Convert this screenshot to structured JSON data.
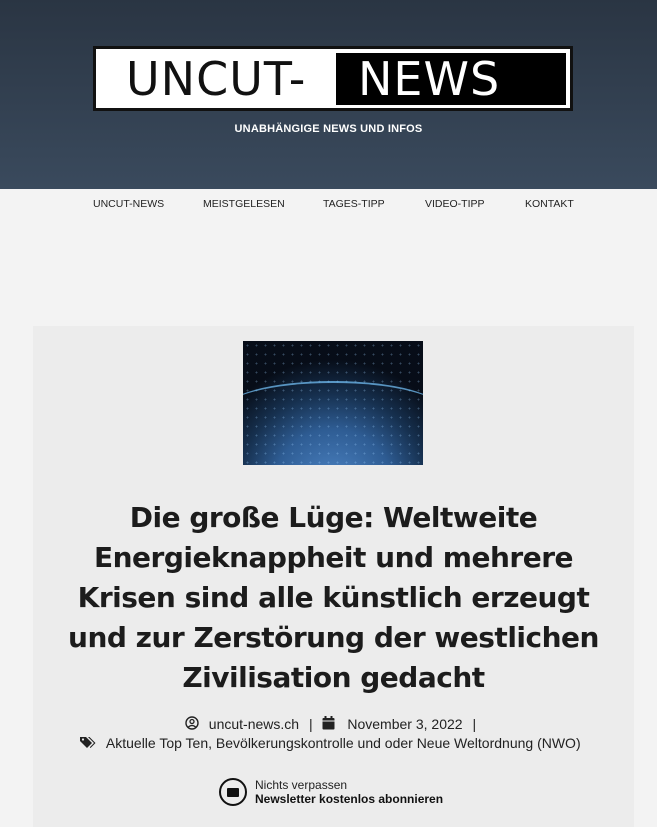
{
  "header": {
    "logo_left": "UNCUT-",
    "logo_right": "NEWS",
    "tagline": "UNABHÄNGIGE NEWS UND INFOS"
  },
  "nav": {
    "items": [
      {
        "label": "UNCUT-NEWS"
      },
      {
        "label": "MEISTGELESEN"
      },
      {
        "label": "TAGES-TIPP"
      },
      {
        "label": "VIDEO-TIPP"
      },
      {
        "label": "KONTAKT"
      }
    ]
  },
  "article": {
    "title": "Die große Lüge: Weltweite Energieknappheit und mehrere Krisen sind alle künstlich erzeugt und zur Zerstörung der westlichen Zivilisation gedacht",
    "author": "uncut-news.ch",
    "date": "November 3, 2022",
    "categories": [
      "Aktuelle Top Ten",
      "Bevölkerungskontrolle und oder Neue Weltordnung (NWO)"
    ],
    "cat_sep": ", "
  },
  "newsletter": {
    "line1": "Nichts verpassen",
    "line2": "Newsletter kostenlos abonnieren"
  },
  "icons": {
    "author": "user-circle-icon",
    "date": "calendar-icon",
    "categories": "tags-icon",
    "newsletter": "envelope-icon"
  }
}
